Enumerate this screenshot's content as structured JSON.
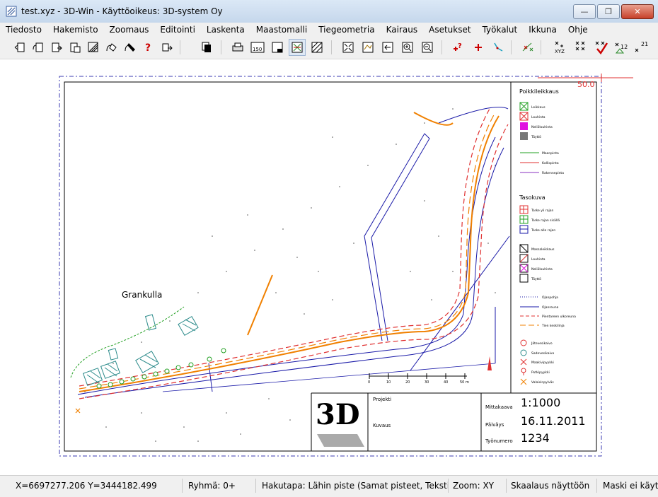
{
  "window": {
    "title": "test.xyz - 3D-Win - Käyttöoikeus: 3D-system Oy",
    "minimize_label": "—",
    "maximize_label": "❐",
    "close_label": "✕"
  },
  "menu": {
    "items": [
      "Tiedosto",
      "Hakemisto",
      "Zoomaus",
      "Editointi",
      "Laskenta",
      "Maastomalli",
      "Tiegeometria",
      "Kairaus",
      "Asetukset",
      "Työkalut",
      "Ikkuna",
      "Ohje"
    ]
  },
  "toolbar": {
    "icons": [
      "open-file-icon",
      "open-point-icon",
      "save-icon",
      "save-as-icon",
      "export-icon",
      "import-icon",
      "draw-icon",
      "query-icon",
      "undo-icon",
      "copy-icon",
      "print-icon",
      "print-scale-icon",
      "layout-icon",
      "grid-icon",
      "hatch-icon",
      "fit-view-icon",
      "view-3d-icon",
      "previous-view-icon",
      "zoom-in-icon",
      "zoom-out-icon",
      "add-query-point-icon",
      "add-point-icon",
      "line-icon",
      "profile-icon",
      "xyz-icon",
      "cross-points-icon",
      "check-icon",
      "number-icon",
      "label-icon"
    ]
  },
  "drawing": {
    "place_name": "Grankulla",
    "scale_marker": "50.0",
    "scalebar_ticks": [
      "0",
      "10",
      "20",
      "30",
      "40",
      "50 m"
    ],
    "legend": {
      "heading1": "Poikkileikkaus",
      "items1": [
        "Leikkaus",
        "Louhinta",
        "Neliölouhinta",
        "Täyttö"
      ],
      "lines1": [
        "Maanpinta",
        "Kalliopinta",
        "Rakennepinta"
      ],
      "heading2": "Tasokuva",
      "items2": [
        "Tarke yli rajan",
        "Tarke rajan sisällä",
        "Tarke alle rajan"
      ],
      "items3": [
        "Massaleikkaus",
        "Louhinta",
        "Neliölouhinta",
        "Täyttö"
      ],
      "lines2": [
        "Ojanpohja",
        "Ojanreuna",
        "Pientareen ulkoreuna",
        "Tien keskilinja"
      ],
      "symbols": [
        "Jätevesikaivo",
        "Sadevesikaivo",
        "Maakivipyykki",
        "Putkipyykki",
        "Valaisinpylväs"
      ]
    },
    "title_block": {
      "project_label": "Projekti",
      "description_label": "Kuvaus",
      "scale_label": "Mittakaava",
      "scale_value": "1:1000",
      "date_label": "Päiväys",
      "date_value": "16.11.2011",
      "job_label": "Työnumero",
      "job_value": "1234",
      "logo_text": "3D"
    }
  },
  "statusbar": {
    "coords": "X=6697277.206  Y=3444182.499",
    "group": "Ryhmä: 0+",
    "search_mode": "Hakutapa: Lähin piste (Samat pisteet, Tekstit)",
    "zoom": "Zoom: XY",
    "scaling": "Skaalaus näyttöön",
    "mask": "Maski ei käytössä"
  },
  "colors": {
    "road_orange": "#f08000",
    "road_red": "#e03030",
    "ditch_blue": "#1a1aa8",
    "green": "#22a022",
    "teal": "#2a8a8a",
    "frame_blue": "#3a3ab0"
  }
}
